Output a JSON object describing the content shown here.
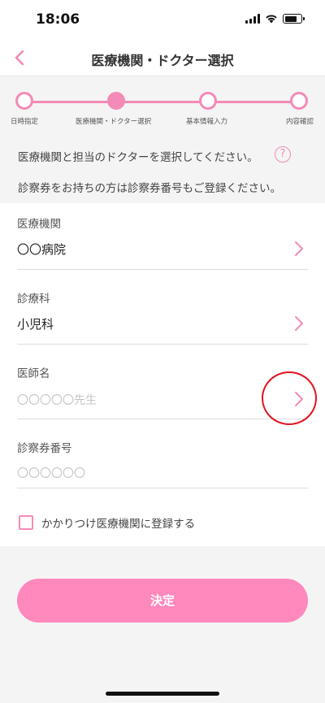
{
  "status_bar": {
    "time": "18:06",
    "icons": [
      "signal-icon",
      "wifi-icon",
      "battery-icon"
    ]
  },
  "nav": {
    "title": "医療機関・ドクター選択",
    "back_icon": "chevron-left-icon"
  },
  "stepper": {
    "current_step": 2,
    "steps": [
      {
        "label": "日時指定",
        "active": false
      },
      {
        "label": "医療機関・ドクター選択",
        "active": true
      },
      {
        "label": "基本情報入力",
        "active": false
      },
      {
        "label": "内容確認",
        "active": false
      }
    ]
  },
  "intro": {
    "line1": "医療機関と担当のドクターを選択してください。",
    "help_icon_text": "?",
    "line2": "診察券をお持ちの方は診察券番号もご登録ください。"
  },
  "form": {
    "institution": {
      "label": "医療機関",
      "value": "〇〇病院"
    },
    "department": {
      "label": "診療科",
      "value": "小児科"
    },
    "doctor": {
      "label": "医師名",
      "placeholder": "〇〇〇〇〇先生"
    },
    "card_number": {
      "label": "診察券番号",
      "placeholder": "〇〇〇〇〇〇"
    },
    "register_checkbox": {
      "label": "かかりつけ医療機関に登録する",
      "checked": false
    }
  },
  "submit": {
    "label": "決定"
  },
  "colors": {
    "accent": "#f48ab8",
    "button": "#ff88bd",
    "annotation": "#e0141f",
    "background": "#f4f4f4"
  }
}
